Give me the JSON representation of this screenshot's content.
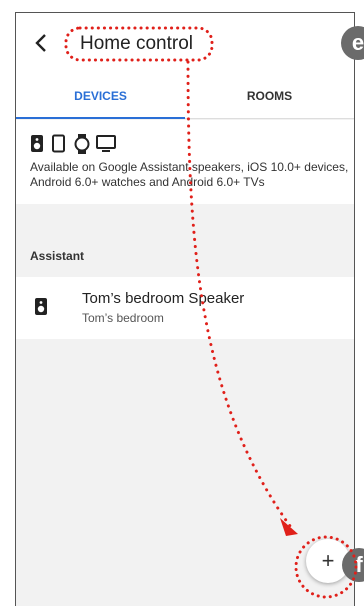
{
  "header": {
    "title": "Home control",
    "back_icon": "chevron-left-icon"
  },
  "tabs": [
    {
      "label": "DEVICES",
      "active": true
    },
    {
      "label": "ROOMS",
      "active": false
    }
  ],
  "availability": {
    "icons": [
      "speaker-icon",
      "phone-icon",
      "watch-icon",
      "tv-icon"
    ],
    "text": "Available on Google Assistant speakers, iOS 10.0+ devices, Android 6.0+ watches and Android 6.0+ TVs"
  },
  "section": {
    "label": "Assistant"
  },
  "device": {
    "name": "Tom’s bedroom Speaker",
    "room": "Tom’s bedroom",
    "icon": "speaker-icon"
  },
  "fab": {
    "label": "+",
    "icon": "plus-icon"
  },
  "annotations": {
    "e": "e",
    "f": "f"
  },
  "colors": {
    "accent": "#2a6fd6",
    "annotation_red": "#e0201a",
    "badge_gray": "#6b6b6b"
  }
}
